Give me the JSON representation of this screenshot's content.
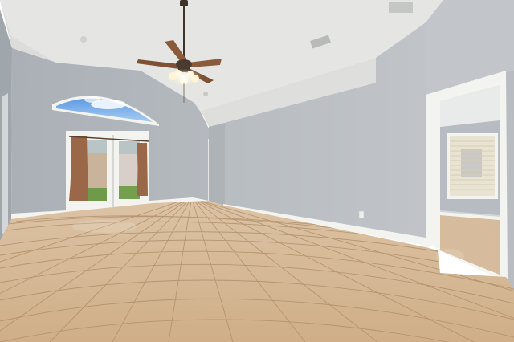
{
  "scene": {
    "description_free": true,
    "colors": {
      "ceiling": "#e6e7e5",
      "ceiling_shadow": "#d4d6d4",
      "wall_left": "#a7adb2",
      "wall_back": "#b2b7bc",
      "wall_right": "#bcc1c5",
      "wall_far_right": "#c3c7cb",
      "floor": "#d6b896",
      "floor_dark": "#c8a680",
      "grout": "#a98c6a",
      "trim": "#f3f3f0",
      "sky": "#7fb1e8",
      "curtain": "#9a6848",
      "blind": "#e9e3d2",
      "fan_blade": "#8a5a3a",
      "fan_metal": "#4a3a30",
      "light_glow": "#fff6d8"
    },
    "fixtures": [
      "ceiling-fan",
      "arched-window",
      "french-doors",
      "doorway",
      "window-with-blinds",
      "air-vent",
      "outlet"
    ]
  }
}
